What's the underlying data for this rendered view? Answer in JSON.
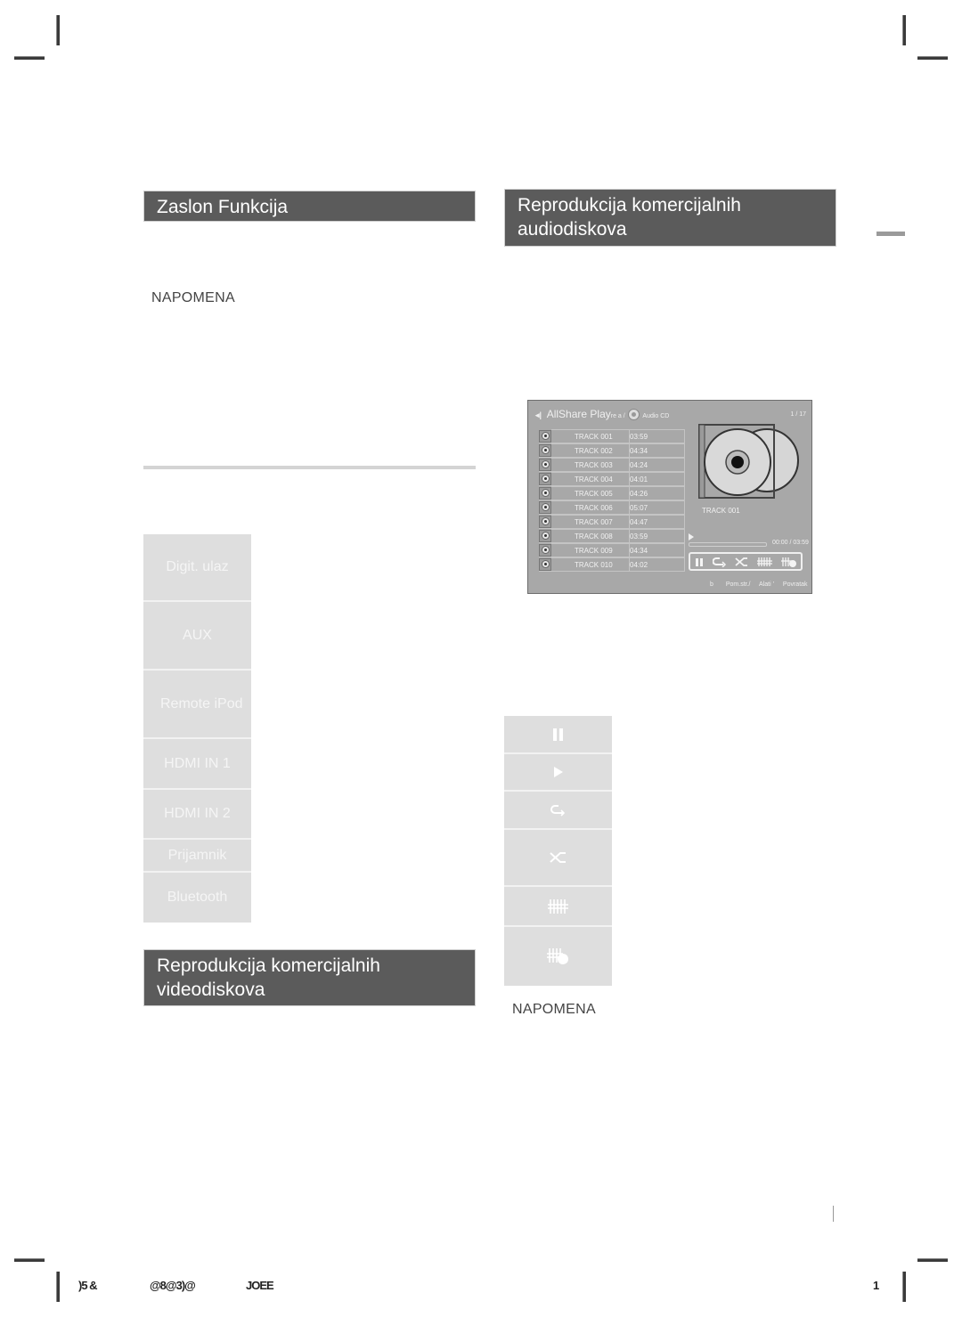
{
  "left_column": {
    "header_function_display": "Zaslon Funkcija",
    "note_label": "NAPOMENA",
    "function_items": [
      {
        "label": "Digit. ulaz"
      },
      {
        "label": "AUX"
      },
      {
        "label": "Remote iPod"
      },
      {
        "label": "HDMI IN 1"
      },
      {
        "label": "HDMI IN 2"
      },
      {
        "label": "Prijamnik"
      },
      {
        "label": "Bluetooth"
      }
    ],
    "header_video_discs": "Reprodukcija komercijalnih videodiskova"
  },
  "right_column": {
    "header_audio_discs": "Reprodukcija komercijalnih audiodiskova",
    "note_label": "NAPOMENA",
    "control_icons": [
      {
        "icon": "pause-icon"
      },
      {
        "icon": "play-icon"
      },
      {
        "icon": "repeat-icon"
      },
      {
        "icon": "shuffle-icon"
      },
      {
        "icon": "equalizer-icon"
      },
      {
        "icon": "sound-effect-icon"
      }
    ]
  },
  "player_screen": {
    "app_title": "AllShare Play",
    "breadcrumb_overlap": "re a /",
    "source": "Audio CD",
    "counter": "1 / 17",
    "tracks": [
      {
        "name": "TRACK 001",
        "duration": "03:59"
      },
      {
        "name": "TRACK 002",
        "duration": "04:34"
      },
      {
        "name": "TRACK 003",
        "duration": "04:24"
      },
      {
        "name": "TRACK 004",
        "duration": "04:01"
      },
      {
        "name": "TRACK 005",
        "duration": "04:26"
      },
      {
        "name": "TRACK 006",
        "duration": "05:07"
      },
      {
        "name": "TRACK 007",
        "duration": "04:47"
      },
      {
        "name": "TRACK 008",
        "duration": "03:59"
      },
      {
        "name": "TRACK 009",
        "duration": "04:34"
      },
      {
        "name": "TRACK 010",
        "duration": "04:02"
      }
    ],
    "now_playing": "TRACK 001",
    "progress_time": "00:00 / 03:59",
    "progress_fraction": 0,
    "footer": {
      "b": "b",
      "page": "Pom.str./",
      "tools": "Alati '",
      "back": "Povratak"
    }
  },
  "page_footer": {
    "left_code": ")5 &",
    "middle_code": "@8@3)@",
    "right_code": "JOEE",
    "page_number": "1"
  }
}
